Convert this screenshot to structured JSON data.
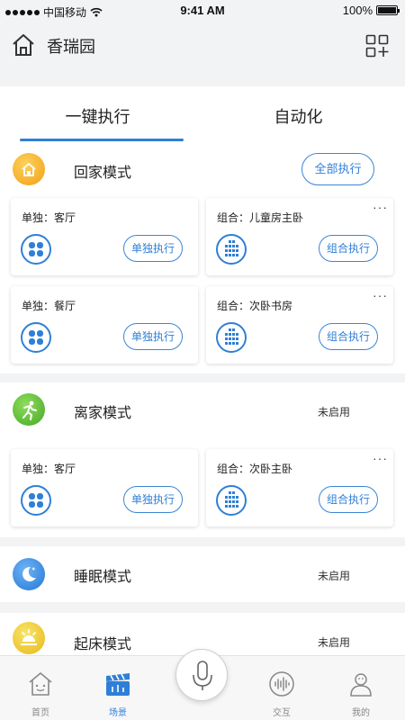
{
  "status_bar": {
    "carrier": "中国移动",
    "time": "9:41 AM",
    "battery": "100%"
  },
  "header": {
    "title": "香瑞园",
    "home_icon": "home-icon",
    "add_icon": "grid-add-icon"
  },
  "tabs": [
    {
      "label": "一键执行",
      "active": true
    },
    {
      "label": "自动化",
      "active": false
    }
  ],
  "scenes": {
    "home": {
      "name": "回家模式",
      "exec_all": "全部执行",
      "color": "#f5b62a",
      "cards": [
        {
          "label": "单独：客厅",
          "button": "单独执行",
          "icon": "four-petal-icon"
        },
        {
          "label": "组合：儿童房主卧",
          "button": "组合执行",
          "icon": "dot-grid-icon",
          "more": "···"
        },
        {
          "label": "单独：餐厅",
          "button": "单独执行",
          "icon": "four-petal-icon"
        },
        {
          "label": "组合：次卧书房",
          "button": "组合执行",
          "icon": "dot-grid-icon",
          "more": "···"
        }
      ]
    },
    "away": {
      "name": "离家模式",
      "status": "未启用",
      "color": "#5dc13a",
      "cards": [
        {
          "label": "单独：客厅",
          "button": "单独执行",
          "icon": "four-petal-icon"
        },
        {
          "label": "组合：次卧主卧",
          "button": "组合执行",
          "icon": "dot-grid-icon",
          "more": "···"
        }
      ]
    },
    "sleep": {
      "name": "睡眠模式",
      "status": "未启用",
      "color": "#3c8ee8"
    },
    "wake": {
      "name": "起床模式",
      "status": "未启用",
      "color": "#f2d43a"
    }
  },
  "tab_bar": [
    {
      "label": "首页",
      "icon": "house-face-icon",
      "active": false
    },
    {
      "label": "场景",
      "icon": "clapperboard-icon",
      "active": true
    },
    {
      "label": "",
      "icon": "microphone-icon",
      "active": false
    },
    {
      "label": "交互",
      "icon": "sound-wave-icon",
      "active": false
    },
    {
      "label": "我的",
      "icon": "user-icon",
      "active": false
    }
  ]
}
